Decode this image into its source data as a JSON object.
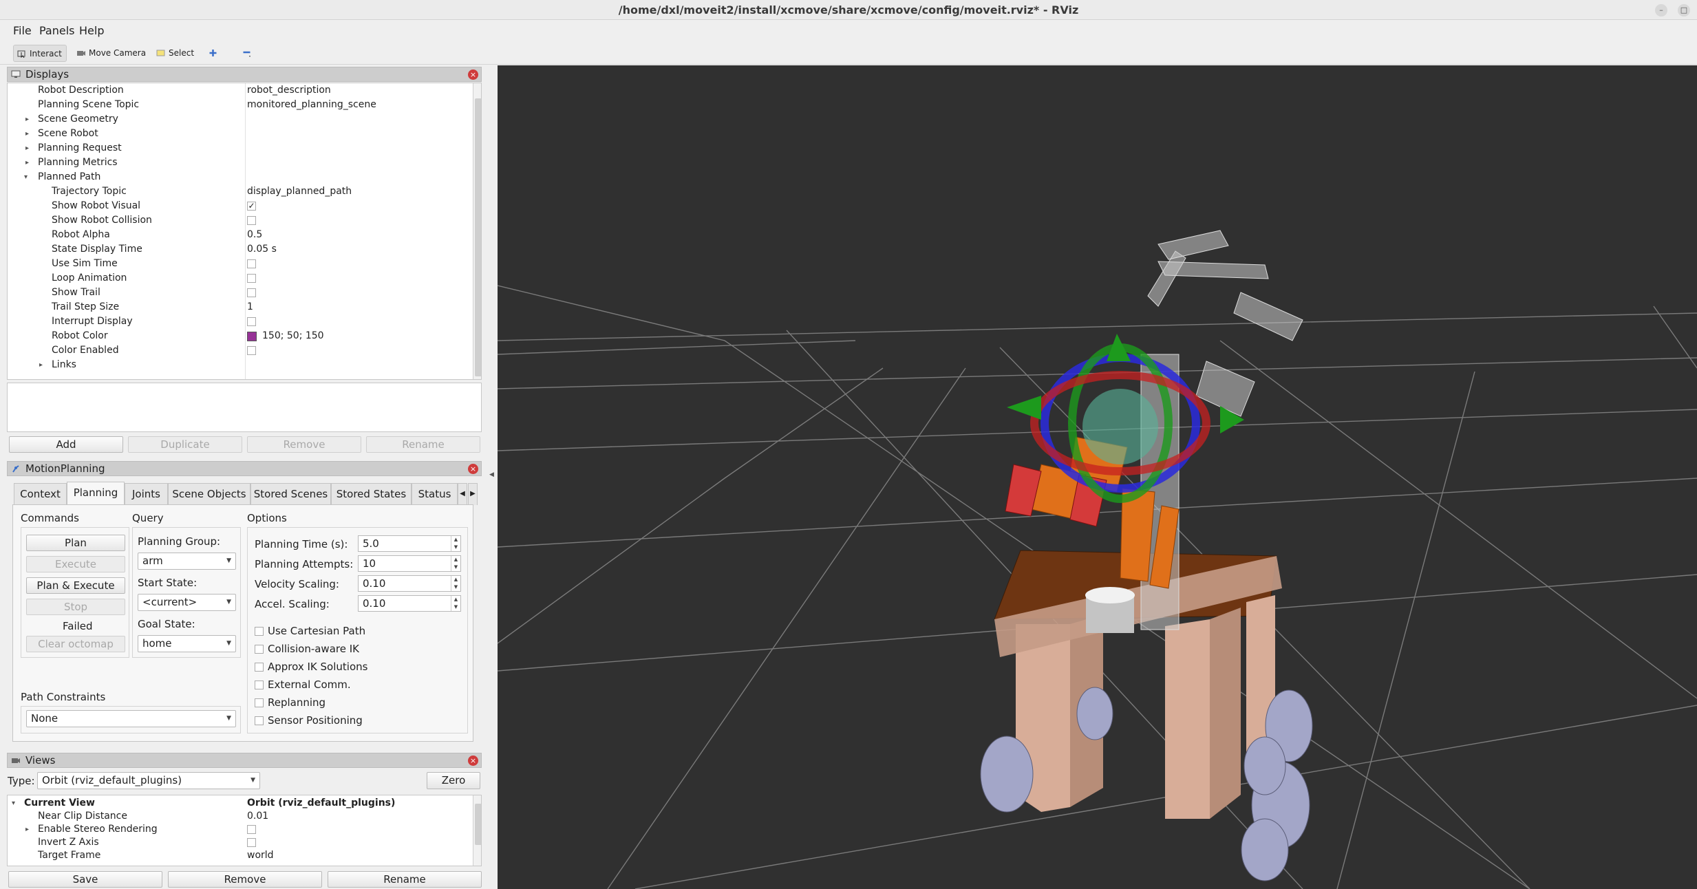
{
  "window": {
    "title": "/home/dxl/moveit2/install/xcmove/share/xcmove/config/moveit.rviz* - RViz"
  },
  "menu": {
    "file": "File",
    "panels": "Panels",
    "help": "Help"
  },
  "toolbar": {
    "interact": "Interact",
    "move_camera": "Move Camera",
    "select": "Select"
  },
  "displays": {
    "title": "Displays",
    "rows": [
      {
        "key": "Robot Description",
        "value": "robot_description"
      },
      {
        "key": "Planning Scene Topic",
        "value": "monitored_planning_scene"
      },
      {
        "key": "Scene Geometry"
      },
      {
        "key": "Scene Robot"
      },
      {
        "key": "Planning Request"
      },
      {
        "key": "Planning Metrics"
      },
      {
        "key": "Planned Path"
      },
      {
        "key": "Trajectory Topic",
        "value": "display_planned_path"
      },
      {
        "key": "Show Robot Visual"
      },
      {
        "key": "Show Robot Collision"
      },
      {
        "key": "Robot Alpha",
        "value": "0.5"
      },
      {
        "key": "State Display Time",
        "value": "0.05 s"
      },
      {
        "key": "Use Sim Time"
      },
      {
        "key": "Loop Animation"
      },
      {
        "key": "Show Trail"
      },
      {
        "key": "Trail Step Size",
        "value": "1"
      },
      {
        "key": "Interrupt Display"
      },
      {
        "key": "Robot Color",
        "value": "150; 50; 150"
      },
      {
        "key": "Color Enabled"
      },
      {
        "key": "Links"
      }
    ],
    "robot_color_hex": "#963296",
    "buttons": {
      "add": "Add",
      "duplicate": "Duplicate",
      "remove": "Remove",
      "rename": "Rename"
    }
  },
  "motion": {
    "title": "MotionPlanning",
    "tabs": [
      "Context",
      "Planning",
      "Joints",
      "Scene Objects",
      "Stored Scenes",
      "Stored States",
      "Status"
    ],
    "commands": {
      "title": "Commands",
      "plan": "Plan",
      "execute": "Execute",
      "plan_execute": "Plan & Execute",
      "stop": "Stop",
      "status": "Failed",
      "clear": "Clear octomap"
    },
    "query": {
      "title": "Query",
      "group_label": "Planning Group:",
      "group": "arm",
      "start_label": "Start State:",
      "start": "<current>",
      "goal_label": "Goal State:",
      "goal": "home"
    },
    "options": {
      "title": "Options",
      "time_label": "Planning Time (s):",
      "time": "5.0",
      "attempts_label": "Planning Attempts:",
      "attempts": "10",
      "vel_label": "Velocity Scaling:",
      "vel": "0.10",
      "acc_label": "Accel. Scaling:",
      "acc": "0.10",
      "checks": [
        "Use Cartesian Path",
        "Collision-aware IK",
        "Approx IK Solutions",
        "External Comm.",
        "Replanning",
        "Sensor Positioning"
      ]
    },
    "path": {
      "label": "Path Constraints",
      "value": "None"
    }
  },
  "views": {
    "title": "Views",
    "type_label": "Type:",
    "type": "Orbit (rviz_default_plugins)",
    "zero": "Zero",
    "rows": [
      {
        "key": "Current View",
        "value": "Orbit (rviz_default_plugins)"
      },
      {
        "key": "Near Clip Distance",
        "value": "0.01"
      },
      {
        "key": "Enable Stereo Rendering"
      },
      {
        "key": "Invert Z Axis"
      },
      {
        "key": "Target Frame",
        "value": "world"
      }
    ],
    "buttons": {
      "save": "Save",
      "remove": "Remove",
      "rename": "Rename"
    }
  },
  "scene": {
    "background": "#303030",
    "grid": "#a0a0a0",
    "base_color": "#d8ad98",
    "arm_color": "#e0701a",
    "ghost_color": "#bdbdbd",
    "wheel_color": "#a3a6c8"
  }
}
